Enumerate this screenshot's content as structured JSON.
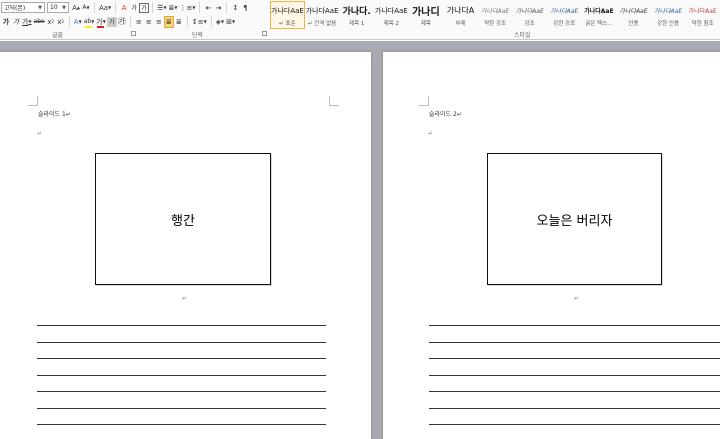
{
  "ribbon": {
    "font": {
      "name": "고딕(본)",
      "size": "10",
      "group_label": "글꼴"
    },
    "paragraph": {
      "group_label": "단락"
    },
    "styles": {
      "group_label": "스타일",
      "items": [
        {
          "preview": "가나다AaE",
          "name": "↵ 표준",
          "selected": true
        },
        {
          "preview": "가나다AaE",
          "name": "↵ 간격 없음"
        },
        {
          "preview": "가나다.",
          "name": "제목 1"
        },
        {
          "preview": "가나다AaE",
          "name": "제목 2"
        },
        {
          "preview": "가나디",
          "name": "제목"
        },
        {
          "preview": "가나다A",
          "name": "부제"
        },
        {
          "preview": "가나다AaE",
          "name": "약한 강조"
        },
        {
          "preview": "가나다AaE",
          "name": "강조"
        },
        {
          "preview": "가나다AaE",
          "name": "강한 강조"
        },
        {
          "preview": "가나다AaE",
          "name": "굵은 텍스..."
        },
        {
          "preview": "가나다AaE",
          "name": "인용"
        },
        {
          "preview": "가나다AaE",
          "name": "강한 인용"
        },
        {
          "preview": "가나다AaE",
          "name": "약한 참조"
        }
      ]
    },
    "buttons": {
      "grow": "A",
      "shrink": "A",
      "case": "Aa",
      "clear": "A",
      "bold": "가",
      "italic": "가",
      "underline": "가",
      "strike": "abe",
      "sub": "x",
      "sup": "x",
      "textfx": "A",
      "highlight": "ab",
      "fontcolor": "가",
      "charborder": "가",
      "phonetic": "가",
      "encircle": "가"
    }
  },
  "pages": [
    {
      "slide_label": "슬라이드 1↵",
      "para_mark": "↵",
      "box_text": "행간",
      "below_mark": "↵"
    },
    {
      "slide_label": "슬라이드 2↵",
      "para_mark": "↵",
      "box_text": "오늘은 버리자",
      "below_mark": "↵"
    }
  ]
}
